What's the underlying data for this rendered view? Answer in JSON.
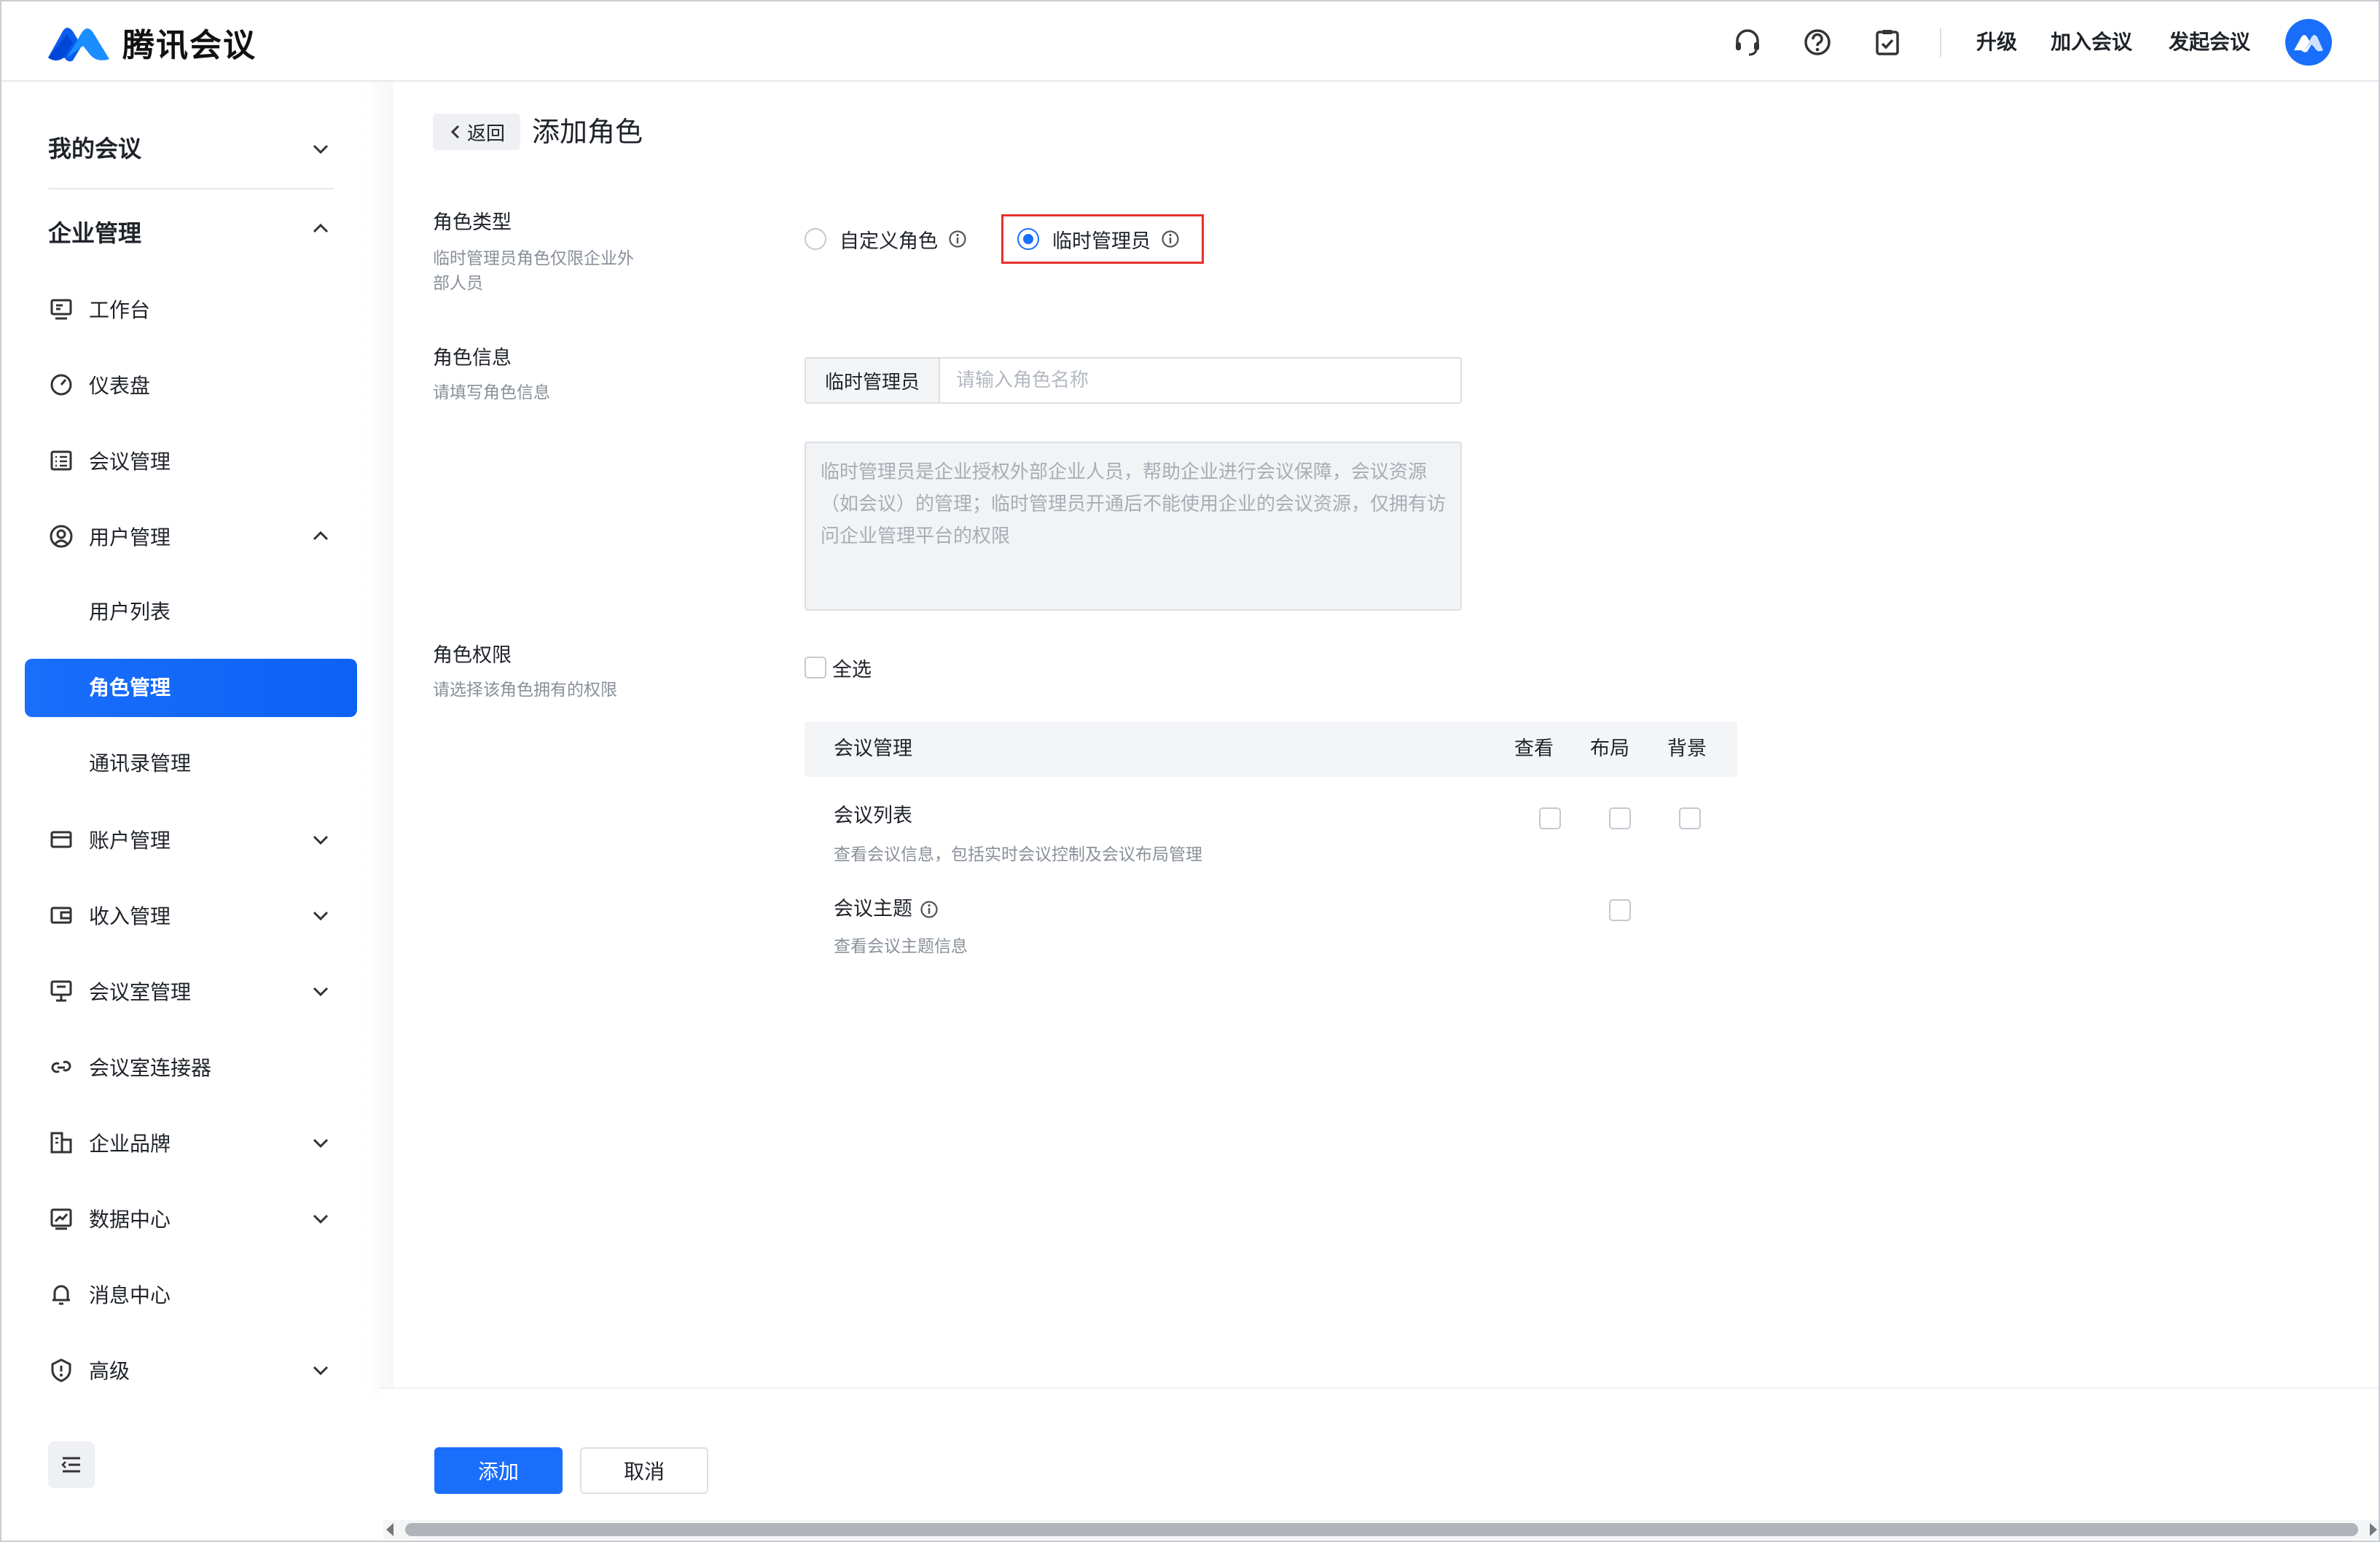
{
  "header": {
    "app_name": "腾讯会议",
    "links": [
      "升级",
      "加入会议",
      "发起会议"
    ],
    "icons": [
      "headset-icon",
      "help-icon",
      "clipboard-check-icon"
    ],
    "brand_color": "#1a6efc"
  },
  "sidebar": {
    "my_meetings": "我的会议",
    "enterprise": "企业管理",
    "items": {
      "workbench": "工作台",
      "dashboard": "仪表盘",
      "meeting_mgmt": "会议管理",
      "user_mgmt": "用户管理",
      "user_list": "用户列表",
      "role_mgmt": "角色管理",
      "contacts_mgmt": "通讯录管理",
      "account_mgmt": "账户管理",
      "income_mgmt": "收入管理",
      "room_mgmt": "会议室管理",
      "room_connector": "会议室连接器",
      "brand": "企业品牌",
      "data_center": "数据中心",
      "message_center": "消息中心",
      "advanced": "高级"
    }
  },
  "main": {
    "back_label": "返回",
    "title": "添加角色",
    "role_type": {
      "label": "角色类型",
      "desc": "临时管理员角色仅限企业外部人员",
      "options": [
        "自定义角色",
        "临时管理员"
      ],
      "selected": "临时管理员"
    },
    "role_info": {
      "label": "角色信息",
      "desc": "请填写角色信息",
      "prefix": "临时管理员",
      "name_placeholder": "请输入角色名称",
      "name_value": "",
      "description": "临时管理员是企业授权外部企业人员，帮助企业进行会议保障，会议资源（如会议）的管理；临时管理员开通后不能使用企业的会议资源，仅拥有访问企业管理平台的权限"
    },
    "permissions": {
      "label": "角色权限",
      "desc": "请选择该角色拥有的权限",
      "select_all": "全选",
      "group": "会议管理",
      "columns": [
        "查看",
        "布局",
        "背景"
      ],
      "rows": [
        {
          "name": "会议列表",
          "desc": "查看会议信息，包括实时会议控制及会议布局管理"
        },
        {
          "name": "会议主题",
          "desc": "查看会议主题信息"
        }
      ]
    }
  },
  "footer": {
    "add_label": "添加",
    "cancel_label": "取消"
  }
}
